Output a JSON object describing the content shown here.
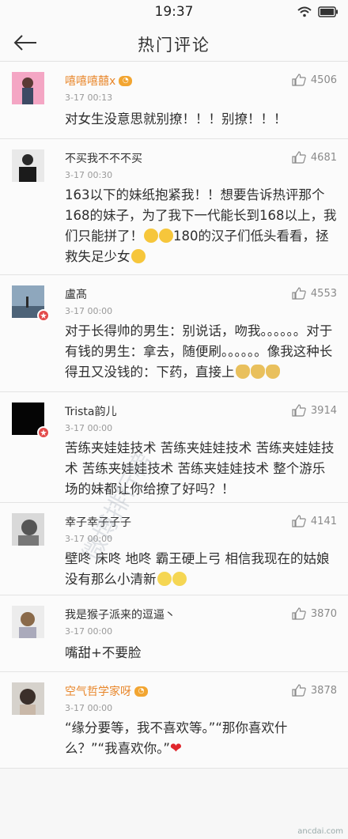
{
  "status": {
    "time": "19:37"
  },
  "header": {
    "title": "热门评论"
  },
  "comments": [
    {
      "name": "嘻嘻嘻囍x",
      "time": "3-17 00:13",
      "likes": "4506",
      "text": "对女生没意思就别撩！！！别撩！！！"
    },
    {
      "name": "不买我不不不买",
      "time": "3-17 00:30",
      "likes": "4681",
      "text": "163以下的妹纸抱紧我！！想要告诉热评那个168的妹子，为了我下一代能长到168以上，我们只能拼了！",
      "text2": "180的汉子们低头看看，拯救失足少女"
    },
    {
      "name": "盧髙",
      "time": "3-17 00:00",
      "likes": "4553",
      "text": "对于长得帅的男生：别说话，吻我。。。。。。对于有钱的男生：拿去，随便刷。。。。。。像我这种长得丑又没钱的：下药，直接上"
    },
    {
      "name": "Trista韵儿",
      "time": "3-17 00:00",
      "likes": "3914",
      "text": "苦练夹娃娃技术 苦练夹娃娃技术 苦练夹娃娃技术 苦练夹娃娃技术 苦练夹娃娃技术 整个游乐场的妹都让你给撩了好吗？！"
    },
    {
      "name": "幸子幸子子子",
      "time": "3-17 00:00",
      "likes": "4141",
      "text": "壁咚 床咚 地咚  霸王硬上弓 相信我现在的姑娘没有那么小清新"
    },
    {
      "name": "我是猴子派来的逗逼丶",
      "time": "3-17 00:00",
      "likes": "3870",
      "text": "嘴甜+不要脸"
    },
    {
      "name": "空气哲学家呀",
      "time": "3-17 00:00",
      "likes": "3878",
      "text": "“缘分要等，我不喜欢等。”“那你喜欢什么？”“我喜欢你。”"
    }
  ],
  "watermark": "微博排行榜",
  "footer": "ancdai.com",
  "colors": {
    "vip_name": "#e8862a",
    "heart": "#e0262c"
  }
}
